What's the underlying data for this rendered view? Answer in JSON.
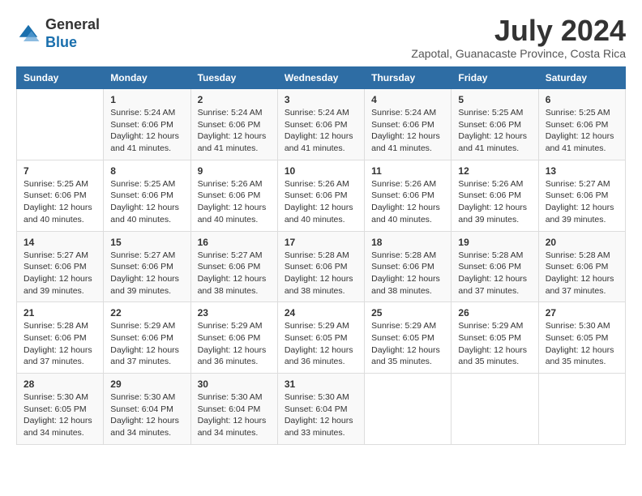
{
  "header": {
    "logo_general": "General",
    "logo_blue": "Blue",
    "month_title": "July 2024",
    "subtitle": "Zapotal, Guanacaste Province, Costa Rica"
  },
  "calendar": {
    "days_of_week": [
      "Sunday",
      "Monday",
      "Tuesday",
      "Wednesday",
      "Thursday",
      "Friday",
      "Saturday"
    ],
    "weeks": [
      [
        {
          "day": "",
          "sunrise": "",
          "sunset": "",
          "daylight": ""
        },
        {
          "day": "1",
          "sunrise": "Sunrise: 5:24 AM",
          "sunset": "Sunset: 6:06 PM",
          "daylight": "Daylight: 12 hours and 41 minutes."
        },
        {
          "day": "2",
          "sunrise": "Sunrise: 5:24 AM",
          "sunset": "Sunset: 6:06 PM",
          "daylight": "Daylight: 12 hours and 41 minutes."
        },
        {
          "day": "3",
          "sunrise": "Sunrise: 5:24 AM",
          "sunset": "Sunset: 6:06 PM",
          "daylight": "Daylight: 12 hours and 41 minutes."
        },
        {
          "day": "4",
          "sunrise": "Sunrise: 5:24 AM",
          "sunset": "Sunset: 6:06 PM",
          "daylight": "Daylight: 12 hours and 41 minutes."
        },
        {
          "day": "5",
          "sunrise": "Sunrise: 5:25 AM",
          "sunset": "Sunset: 6:06 PM",
          "daylight": "Daylight: 12 hours and 41 minutes."
        },
        {
          "day": "6",
          "sunrise": "Sunrise: 5:25 AM",
          "sunset": "Sunset: 6:06 PM",
          "daylight": "Daylight: 12 hours and 41 minutes."
        }
      ],
      [
        {
          "day": "7",
          "sunrise": "Sunrise: 5:25 AM",
          "sunset": "Sunset: 6:06 PM",
          "daylight": "Daylight: 12 hours and 40 minutes."
        },
        {
          "day": "8",
          "sunrise": "Sunrise: 5:25 AM",
          "sunset": "Sunset: 6:06 PM",
          "daylight": "Daylight: 12 hours and 40 minutes."
        },
        {
          "day": "9",
          "sunrise": "Sunrise: 5:26 AM",
          "sunset": "Sunset: 6:06 PM",
          "daylight": "Daylight: 12 hours and 40 minutes."
        },
        {
          "day": "10",
          "sunrise": "Sunrise: 5:26 AM",
          "sunset": "Sunset: 6:06 PM",
          "daylight": "Daylight: 12 hours and 40 minutes."
        },
        {
          "day": "11",
          "sunrise": "Sunrise: 5:26 AM",
          "sunset": "Sunset: 6:06 PM",
          "daylight": "Daylight: 12 hours and 40 minutes."
        },
        {
          "day": "12",
          "sunrise": "Sunrise: 5:26 AM",
          "sunset": "Sunset: 6:06 PM",
          "daylight": "Daylight: 12 hours and 39 minutes."
        },
        {
          "day": "13",
          "sunrise": "Sunrise: 5:27 AM",
          "sunset": "Sunset: 6:06 PM",
          "daylight": "Daylight: 12 hours and 39 minutes."
        }
      ],
      [
        {
          "day": "14",
          "sunrise": "Sunrise: 5:27 AM",
          "sunset": "Sunset: 6:06 PM",
          "daylight": "Daylight: 12 hours and 39 minutes."
        },
        {
          "day": "15",
          "sunrise": "Sunrise: 5:27 AM",
          "sunset": "Sunset: 6:06 PM",
          "daylight": "Daylight: 12 hours and 39 minutes."
        },
        {
          "day": "16",
          "sunrise": "Sunrise: 5:27 AM",
          "sunset": "Sunset: 6:06 PM",
          "daylight": "Daylight: 12 hours and 38 minutes."
        },
        {
          "day": "17",
          "sunrise": "Sunrise: 5:28 AM",
          "sunset": "Sunset: 6:06 PM",
          "daylight": "Daylight: 12 hours and 38 minutes."
        },
        {
          "day": "18",
          "sunrise": "Sunrise: 5:28 AM",
          "sunset": "Sunset: 6:06 PM",
          "daylight": "Daylight: 12 hours and 38 minutes."
        },
        {
          "day": "19",
          "sunrise": "Sunrise: 5:28 AM",
          "sunset": "Sunset: 6:06 PM",
          "daylight": "Daylight: 12 hours and 37 minutes."
        },
        {
          "day": "20",
          "sunrise": "Sunrise: 5:28 AM",
          "sunset": "Sunset: 6:06 PM",
          "daylight": "Daylight: 12 hours and 37 minutes."
        }
      ],
      [
        {
          "day": "21",
          "sunrise": "Sunrise: 5:28 AM",
          "sunset": "Sunset: 6:06 PM",
          "daylight": "Daylight: 12 hours and 37 minutes."
        },
        {
          "day": "22",
          "sunrise": "Sunrise: 5:29 AM",
          "sunset": "Sunset: 6:06 PM",
          "daylight": "Daylight: 12 hours and 37 minutes."
        },
        {
          "day": "23",
          "sunrise": "Sunrise: 5:29 AM",
          "sunset": "Sunset: 6:06 PM",
          "daylight": "Daylight: 12 hours and 36 minutes."
        },
        {
          "day": "24",
          "sunrise": "Sunrise: 5:29 AM",
          "sunset": "Sunset: 6:05 PM",
          "daylight": "Daylight: 12 hours and 36 minutes."
        },
        {
          "day": "25",
          "sunrise": "Sunrise: 5:29 AM",
          "sunset": "Sunset: 6:05 PM",
          "daylight": "Daylight: 12 hours and 35 minutes."
        },
        {
          "day": "26",
          "sunrise": "Sunrise: 5:29 AM",
          "sunset": "Sunset: 6:05 PM",
          "daylight": "Daylight: 12 hours and 35 minutes."
        },
        {
          "day": "27",
          "sunrise": "Sunrise: 5:30 AM",
          "sunset": "Sunset: 6:05 PM",
          "daylight": "Daylight: 12 hours and 35 minutes."
        }
      ],
      [
        {
          "day": "28",
          "sunrise": "Sunrise: 5:30 AM",
          "sunset": "Sunset: 6:05 PM",
          "daylight": "Daylight: 12 hours and 34 minutes."
        },
        {
          "day": "29",
          "sunrise": "Sunrise: 5:30 AM",
          "sunset": "Sunset: 6:04 PM",
          "daylight": "Daylight: 12 hours and 34 minutes."
        },
        {
          "day": "30",
          "sunrise": "Sunrise: 5:30 AM",
          "sunset": "Sunset: 6:04 PM",
          "daylight": "Daylight: 12 hours and 34 minutes."
        },
        {
          "day": "31",
          "sunrise": "Sunrise: 5:30 AM",
          "sunset": "Sunset: 6:04 PM",
          "daylight": "Daylight: 12 hours and 33 minutes."
        },
        {
          "day": "",
          "sunrise": "",
          "sunset": "",
          "daylight": ""
        },
        {
          "day": "",
          "sunrise": "",
          "sunset": "",
          "daylight": ""
        },
        {
          "day": "",
          "sunrise": "",
          "sunset": "",
          "daylight": ""
        }
      ]
    ]
  }
}
